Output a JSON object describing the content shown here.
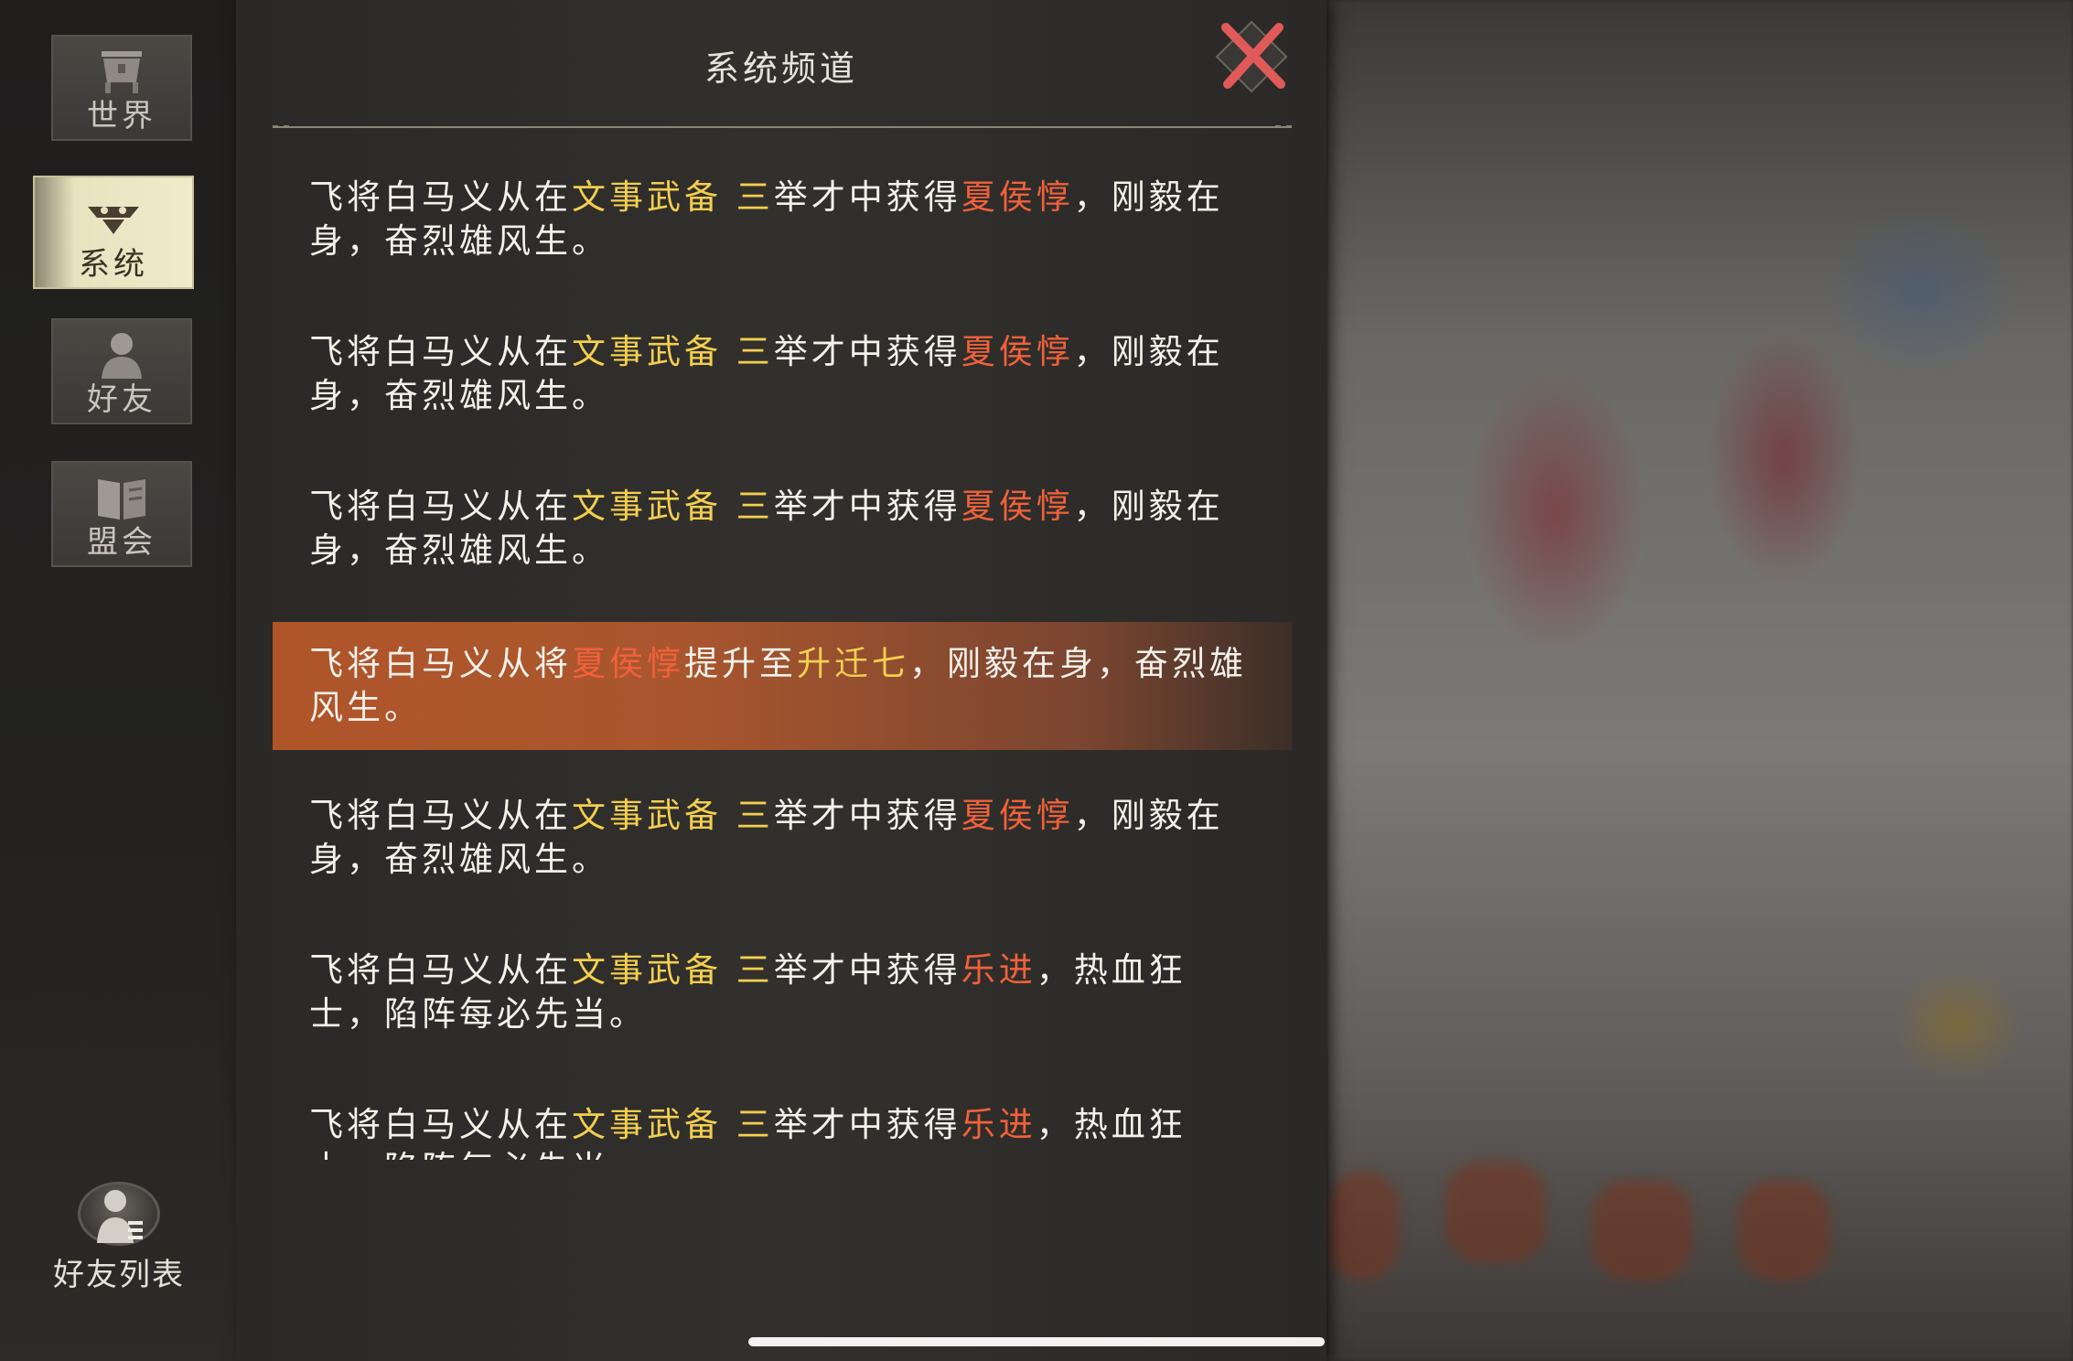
{
  "panel": {
    "title": "系统频道"
  },
  "tabs": [
    {
      "label": "世界",
      "icon": "cauldron-icon"
    },
    {
      "label": "系统",
      "icon": "system-emblem-icon",
      "active": true
    },
    {
      "label": "好友",
      "icon": "friend-portrait-icon"
    },
    {
      "label": "盟会",
      "icon": "book-icon"
    }
  ],
  "friend_list": {
    "label": "好友列表",
    "icon": "friend-list-icon"
  },
  "messages": [
    {
      "p1": "飞将白马义从在",
      "event": "文事武备 三",
      "p2": "举才中获得",
      "hero": "夏侯惇",
      "p3": "，刚毅在身，奋烈雄风生。"
    },
    {
      "p1": "飞将白马义从在",
      "event": "文事武备 三",
      "p2": "举才中获得",
      "hero": "夏侯惇",
      "p3": "，刚毅在身，奋烈雄风生。"
    },
    {
      "p1": "飞将白马义从在",
      "event": "文事武备 三",
      "p2": "举才中获得",
      "hero": "夏侯惇",
      "p3": "，刚毅在身，奋烈雄风生。"
    },
    {
      "p1": "飞将白马义从将",
      "hero": "夏侯惇",
      "p2": "提升至",
      "rank": "升迁七",
      "p3": "，刚毅在身，奋烈雄风生。"
    },
    {
      "p1": "飞将白马义从在",
      "event": "文事武备 三",
      "p2": "举才中获得",
      "hero": "夏侯惇",
      "p3": "，刚毅在身，奋烈雄风生。"
    },
    {
      "p1": "飞将白马义从在",
      "event": "文事武备 三",
      "p2": "举才中获得",
      "hero": "乐进",
      "p3": "，热血狂士，陷阵每必先当。"
    },
    {
      "p1": "飞将白马义从在",
      "event": "文事武备 三",
      "p2": "举才中获得",
      "hero": "乐进",
      "p3": "，热血狂士，陷阵每必先当。"
    }
  ],
  "colors": {
    "event": "#f3cf4f",
    "hero": "#f0613b",
    "highlight": "#b0552a"
  }
}
